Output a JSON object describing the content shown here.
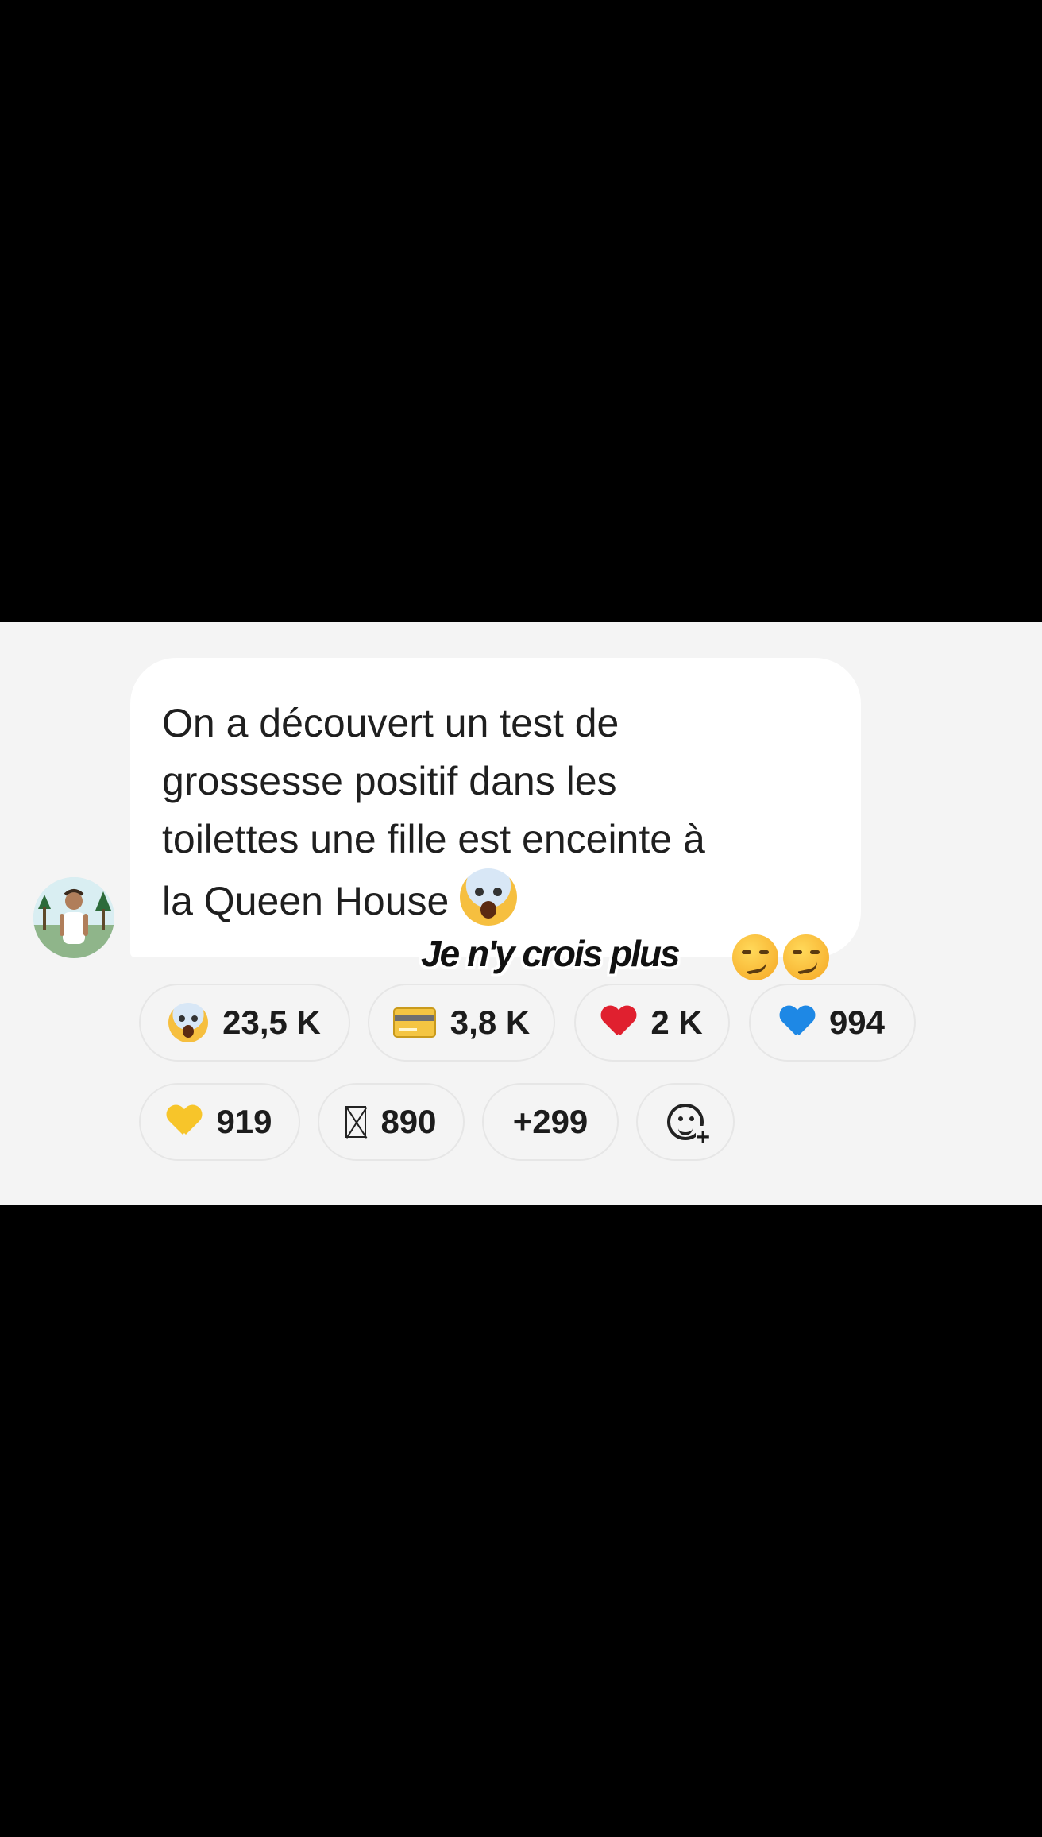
{
  "message": {
    "text": "On a découvert un test de\ngrossesse positif dans les\ntoilettes une fille est enceinte à\nla Queen House",
    "trailing_emoji": "face-screaming-in-fear"
  },
  "overlay": {
    "caption": "Je n'y crois plus",
    "emojis": [
      "smirking-face",
      "smirking-face"
    ]
  },
  "reactions_row1": [
    {
      "emoji": "face-screaming-in-fear",
      "count": "23,5 K"
    },
    {
      "emoji": "credit-card",
      "count": "3,8 K"
    },
    {
      "emoji": "red-heart",
      "count": "2 K"
    },
    {
      "emoji": "blue-heart",
      "count": "994"
    }
  ],
  "reactions_row2": [
    {
      "emoji": "yellow-heart",
      "count": "919"
    },
    {
      "emoji": "unsupported-glyph",
      "count": "890"
    },
    {
      "more": "+299"
    }
  ],
  "colors": {
    "panel": "#f4f4f4",
    "bubble": "#ffffff",
    "red_heart": "#e0202f",
    "blue_heart": "#1e88e5",
    "yellow_heart": "#f7c52a"
  }
}
